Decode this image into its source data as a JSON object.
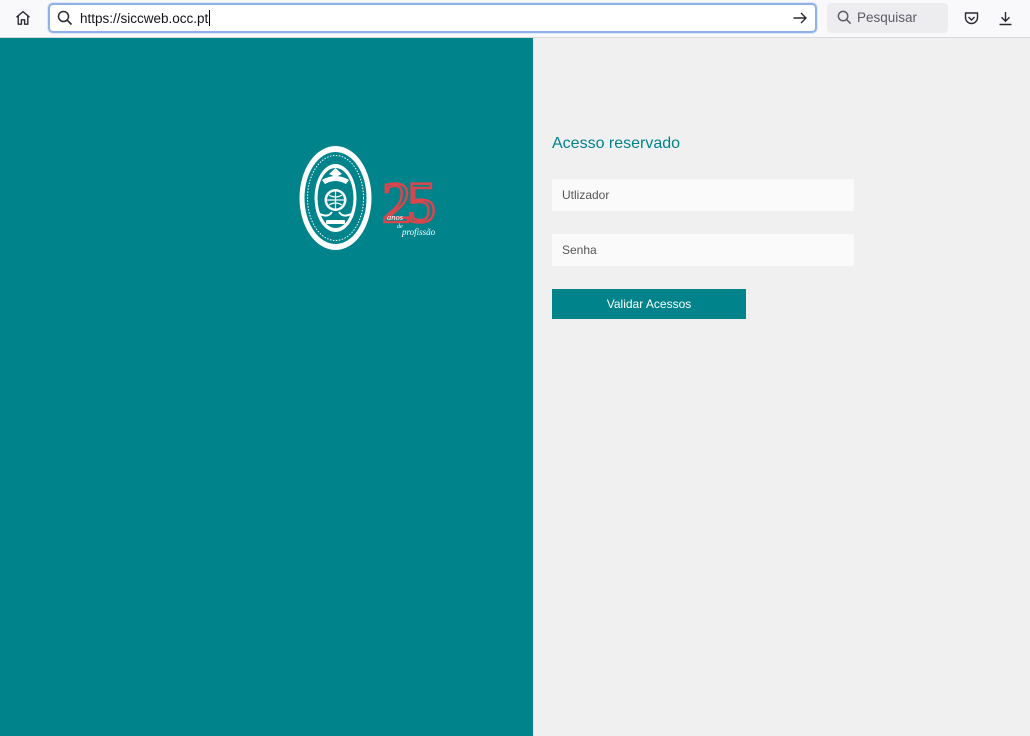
{
  "browser": {
    "url": "https://siccweb.occ.pt",
    "search_placeholder": "Pesquisar",
    "icons": {
      "home": "home-icon",
      "url_search": "search-icon",
      "go": "arrow-right-icon",
      "search": "search-icon",
      "pocket": "pocket-icon",
      "download": "download-icon"
    }
  },
  "page": {
    "colors": {
      "brand": "#00838a",
      "background": "#f0f0f0",
      "logo_accent": "#d9464d"
    },
    "logo": {
      "number": "25",
      "text_anos": "anos",
      "text_de": "de",
      "text_profissao": "profissão"
    },
    "login": {
      "heading": "Acesso reservado",
      "user_placeholder": "Utlizador",
      "password_placeholder": "Senha",
      "submit_label": "Validar Acessos"
    }
  }
}
